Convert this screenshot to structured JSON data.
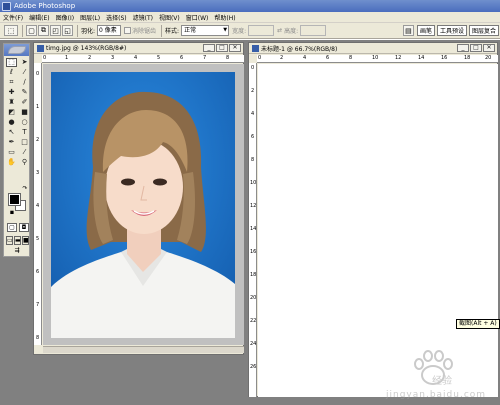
{
  "window": {
    "title": "Adobe Photoshop"
  },
  "menu": [
    "文件(F)",
    "编辑(E)",
    "图像(I)",
    "图层(L)",
    "选择(S)",
    "滤镜(T)",
    "视图(V)",
    "窗口(W)",
    "帮助(H)"
  ],
  "options": {
    "feather_label": "羽化:",
    "feather_value": "0 像素",
    "antialias_label": "消除锯齿",
    "style_label": "样式:",
    "style_value": "正常",
    "width_label": "宽度:",
    "height_label": "高度:"
  },
  "palette_tabs": [
    "画笔",
    "工具预设",
    "图层复合"
  ],
  "documents": {
    "photo": {
      "title": "timg.jpg @ 143%(RGB/8#)",
      "ruler_h": [
        "0",
        "1",
        "2",
        "3",
        "4",
        "5",
        "6",
        "7",
        "8"
      ],
      "ruler_v": [
        "0",
        "1",
        "2",
        "3",
        "4",
        "5",
        "6",
        "7",
        "8"
      ]
    },
    "new": {
      "title": "未标题-1 @ 66.7%(RGB/8)",
      "ruler_h": [
        "0",
        "2",
        "4",
        "6",
        "8",
        "10",
        "12",
        "14",
        "16",
        "18",
        "20"
      ],
      "ruler_v": [
        "0",
        "2",
        "4",
        "6",
        "8",
        "10",
        "12",
        "14",
        "16",
        "18",
        "20",
        "22",
        "24",
        "26"
      ]
    }
  },
  "window_buttons": {
    "minimize": "_",
    "maximize": "□",
    "close": "✕"
  },
  "tooltip": {
    "text": "截图(Alt + A)"
  },
  "watermark": {
    "cn": "经验",
    "en": "jingyan.baidu.com"
  },
  "icons": {
    "toolbox": [
      "marquee-icon",
      "move-icon",
      "lasso-icon",
      "magic-wand-icon",
      "crop-icon",
      "slice-icon",
      "healing-icon",
      "brush-icon",
      "stamp-icon",
      "history-brush-icon",
      "eraser-icon",
      "gradient-icon",
      "blur-icon",
      "dodge-icon",
      "path-select-icon",
      "type-icon",
      "pen-icon",
      "shape-icon",
      "notes-icon",
      "eyedropper-icon",
      "hand-icon",
      "zoom-icon"
    ]
  },
  "colors": {
    "photo_background": "#1f7fd1",
    "title_bar": "#4a6dbd",
    "workspace": "#808080"
  }
}
